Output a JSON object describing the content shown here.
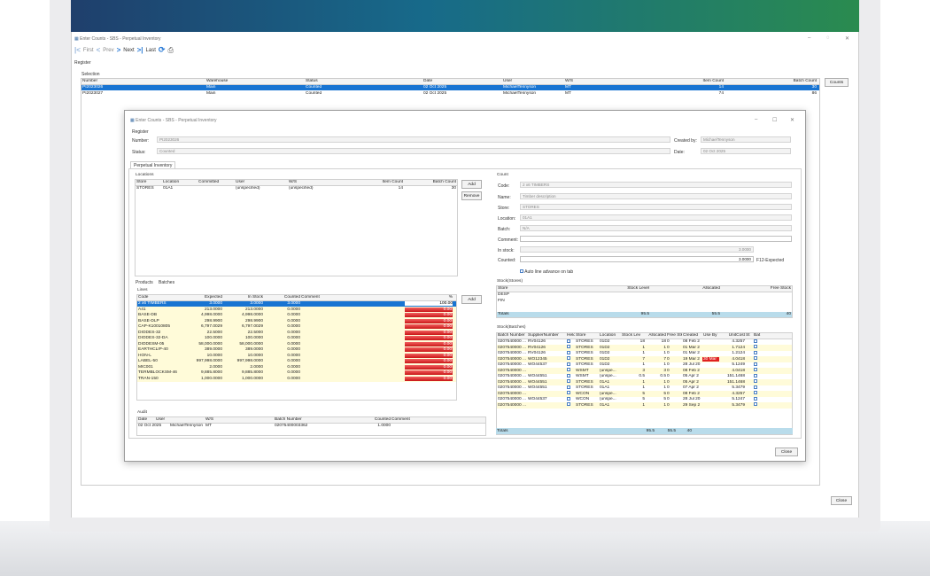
{
  "outer": {
    "title": "Enter Counts - SBS - Perpetual Inventory",
    "toolbar": {
      "first": "First",
      "prev": "Prev",
      "next": "Next",
      "last": "Last"
    },
    "register_label": "Register",
    "selection_label": "Selection",
    "columns": [
      "Number",
      "Warehouse",
      "Status",
      "Date",
      "User",
      "W/S",
      "Item Count",
      "Batch Count"
    ],
    "rows": [
      [
        "PI2023026",
        "Main",
        "Counted",
        "02 Oct 2025",
        "MichaelTennyson",
        "MT",
        "14",
        "30"
      ],
      [
        "PI2023027",
        "Main",
        "Counted",
        "02 Oct 2025",
        "MichaelTennyson",
        "MT",
        "74",
        "86"
      ]
    ],
    "counts_button": "Counts",
    "close_button": "Close"
  },
  "dialog": {
    "title": "Enter Counts - SBS - Perpetual Inventory",
    "register_label": "Register",
    "number_label": "Number:",
    "number_value": "PI2023026",
    "status_label": "Status:",
    "status_value": "Counted",
    "created_by_label": "Created by:",
    "created_by_value": "MichaelTennyson",
    "date_label": "Date:",
    "date_value": "02 Oct 2025",
    "tab": "Perpetual Inventory",
    "locations": {
      "label": "Locations",
      "columns": [
        "Store",
        "Location",
        "Committed",
        "User",
        "W/S",
        "Item Count",
        "Batch Count"
      ],
      "row": [
        "STORES",
        "01A1",
        "",
        "(unspecified)",
        "(unspecified)",
        "14",
        "30"
      ],
      "add": "Add",
      "remove": "Remove"
    },
    "products_tabs": [
      "Products",
      "Batches"
    ],
    "lines": {
      "label": "Lines",
      "columns": [
        "Code",
        "Expected",
        "In Stock",
        "Counted",
        "Comment",
        "%"
      ],
      "add": "Add",
      "rows": [
        [
          "2 x6 TIMBERS",
          "3.0000",
          "3.0000",
          "3.0000",
          "",
          "100.00"
        ],
        [
          "A41",
          "213.0000",
          "213.0000",
          "0.0000",
          "",
          "0.00"
        ],
        [
          "BASE-DB",
          "4,998.0000",
          "4,998.0000",
          "0.0000",
          "",
          "0.00"
        ],
        [
          "BASE-DLP",
          "298.9900",
          "298.9900",
          "0.0000",
          "",
          "0.00"
        ],
        [
          "CAP-K10010805",
          "6,797.0029",
          "6,797.0029",
          "0.0000",
          "",
          "0.00"
        ],
        [
          "DIODES-32",
          "22.5000",
          "22.5000",
          "0.0000",
          "",
          "0.00"
        ],
        [
          "DIODES-32-DA",
          "100.0000",
          "100.0000",
          "0.0000",
          "",
          "0.00"
        ],
        [
          "DIODESM-05",
          "58,000.0000",
          "58,000.0000",
          "0.0000",
          "",
          "0.00"
        ],
        [
          "EARTHCLIP-40",
          "389.0000",
          "389.0000",
          "0.0000",
          "",
          "0.00"
        ],
        [
          "HON-L",
          "10.0000",
          "10.0000",
          "0.0000",
          "",
          "0.00"
        ],
        [
          "LABEL-50",
          "997,998.0000",
          "997,998.0000",
          "0.0000",
          "",
          "0.00"
        ],
        [
          "MIC001",
          "2.0000",
          "2.0000",
          "0.0000",
          "",
          "0.00"
        ],
        [
          "TERMBLOCKSM-46",
          "9,885.8000",
          "9,885.8000",
          "0.0000",
          "",
          "0.00"
        ],
        [
          "TRAN-150",
          "1,000.0000",
          "1,000.0000",
          "0.0000",
          "",
          "0.00"
        ]
      ]
    },
    "audit": {
      "label": "Audit",
      "columns": [
        "Date",
        "User",
        "W/S",
        "Batch Number",
        "Counted",
        "Comment"
      ],
      "row": [
        "02 Oct 2025",
        "MichaelTennyson",
        "MT",
        "02075400003362",
        "1.0000",
        ""
      ]
    },
    "count": {
      "label": "Count",
      "code_label": "Code:",
      "code_value": "2 x6 TIMBERS",
      "name_label": "Name:",
      "name_value": "Timber description",
      "store_label": "Store:",
      "store_value": "STORES",
      "location_label": "Location:",
      "location_value": "01A1",
      "batch_label": "Batch:",
      "batch_value": "N/A",
      "comment_label": "Comment:",
      "instock_label": "In stock:",
      "instock_value": "3.0000",
      "counted_label": "Counted:",
      "counted_value": "3.0000",
      "f12_label": "F12-Expected",
      "auto_label": "Auto line advance on tab"
    },
    "stock_stores": {
      "label": "Stock(Stores)",
      "columns": [
        "Store",
        "Stock Level",
        "Allocated",
        "Free Stock"
      ],
      "rows": [
        [
          "DESP",
          "",
          "",
          ""
        ],
        [
          "FIN",
          "",
          "",
          ""
        ]
      ],
      "totals": [
        "Totals",
        "95.5",
        "55.5",
        "40"
      ]
    },
    "stock_batches": {
      "label": "Stock(Batches)",
      "columns": [
        "Batch Number",
        "SupplierNumber",
        "Held",
        "Store",
        "Location",
        "Stock Lev",
        "Allocated",
        "Free Stk",
        "Created",
        "Use By",
        "UnitCost",
        "St",
        "Bat"
      ],
      "rows": [
        [
          "0207540000 ...",
          "RV04126",
          "",
          "STORES",
          "01D2",
          "18",
          "18",
          "0",
          "08 Feb 2",
          "",
          "4.3257"
        ],
        [
          "0207540000 ...",
          "RV04126",
          "",
          "STORES",
          "01D2",
          "1",
          "1",
          "0",
          "01 Mar 2",
          "",
          "1.7124"
        ],
        [
          "0207540000 ...",
          "RV04126",
          "",
          "STORES",
          "01D2",
          "1",
          "1",
          "0",
          "01 Mar 2",
          "",
          "1.2124"
        ],
        [
          "0207540000 ...",
          "WO12345",
          "",
          "STORES",
          "01D2",
          "7",
          "7",
          "0",
          "19 Mar 2",
          "30 Mar",
          "4.0418"
        ],
        [
          "0207540000 ...",
          "WO44537",
          "",
          "STORES",
          "01D2",
          "1",
          "1",
          "0",
          "28 Jul 20",
          "",
          "5.1249"
        ],
        [
          "0207540000 ...",
          "",
          "",
          "WSMT",
          "(unspe...",
          "3",
          "3",
          "0",
          "08 Feb 2",
          "",
          "4.0418"
        ],
        [
          "0207540000 ...",
          "WO44551",
          "",
          "WSMT",
          "(unspe...",
          "0.5",
          "0.5",
          "0",
          "05 Apr 2",
          "",
          "151.1468"
        ],
        [
          "0207540000 ...",
          "WO44551",
          "",
          "STORES",
          "01A1",
          "1",
          "1",
          "0",
          "05 Apr 2",
          "",
          "151.1468"
        ],
        [
          "0207540000 ...",
          "WO44551",
          "",
          "STORES",
          "01A1",
          "1",
          "1",
          "0",
          "07 Apr 2",
          "",
          "5.3479"
        ],
        [
          "0207540000 ...",
          "",
          "",
          "WCON",
          "(unspe...",
          "5",
          "5",
          "0",
          "08 Feb 2",
          "",
          "4.3257"
        ],
        [
          "0207540000 ...",
          "WO44537",
          "",
          "WCON",
          "(unspe...",
          "5",
          "5",
          "0",
          "28 Jul 20",
          "",
          "5.1247"
        ],
        [
          "0207540000 ...",
          "",
          "",
          "STORES",
          "01A1",
          "1",
          "1",
          "0",
          "29 Sep 2",
          "",
          "5.3479"
        ]
      ],
      "totals": [
        "Totals",
        "95.5",
        "55.5",
        "40"
      ]
    },
    "close": "Close"
  }
}
